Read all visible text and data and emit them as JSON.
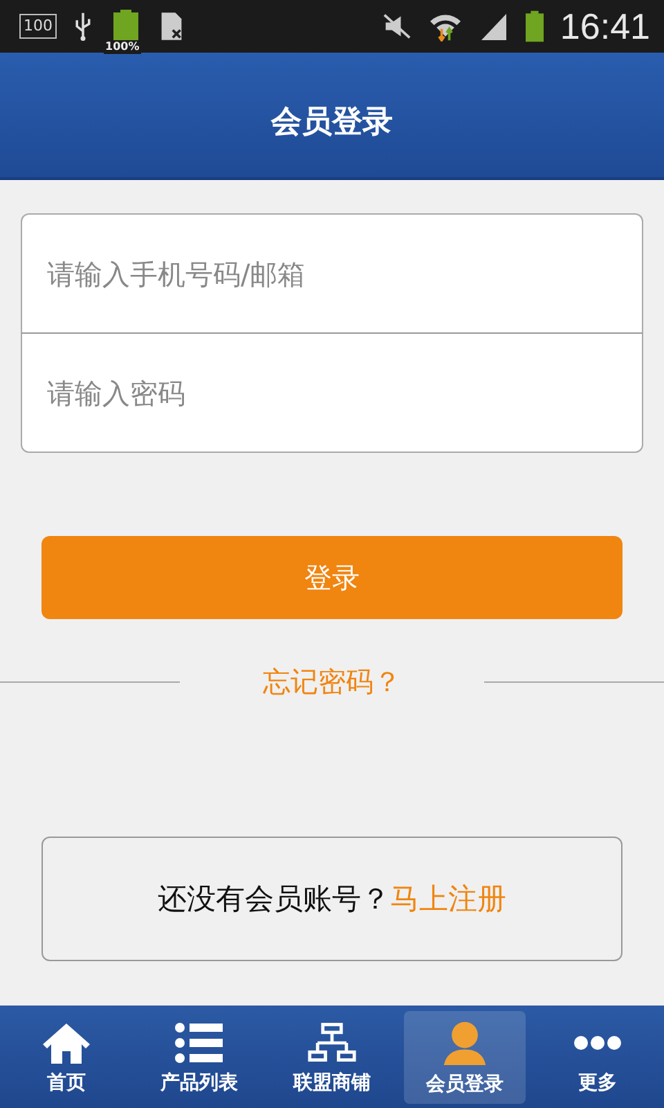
{
  "status_bar": {
    "left_badge": "100",
    "battery_percent": "100%",
    "time": "16:41"
  },
  "header": {
    "title": "会员登录"
  },
  "form": {
    "fields": [
      {
        "placeholder": "请输入手机号码/邮箱"
      },
      {
        "placeholder": "请输入密码"
      }
    ],
    "login_button": "登录",
    "forgot_link": "忘记密码？"
  },
  "register": {
    "text": "还没有会员账号？",
    "link": "马上注册"
  },
  "nav": [
    {
      "label": "首页",
      "kind": "home",
      "selected": false
    },
    {
      "label": "产品列表",
      "kind": "list",
      "selected": false
    },
    {
      "label": "联盟商铺",
      "kind": "tree",
      "selected": false
    },
    {
      "label": "会员登录",
      "kind": "user",
      "selected": true
    },
    {
      "label": "更多",
      "kind": "more",
      "selected": false
    }
  ]
}
